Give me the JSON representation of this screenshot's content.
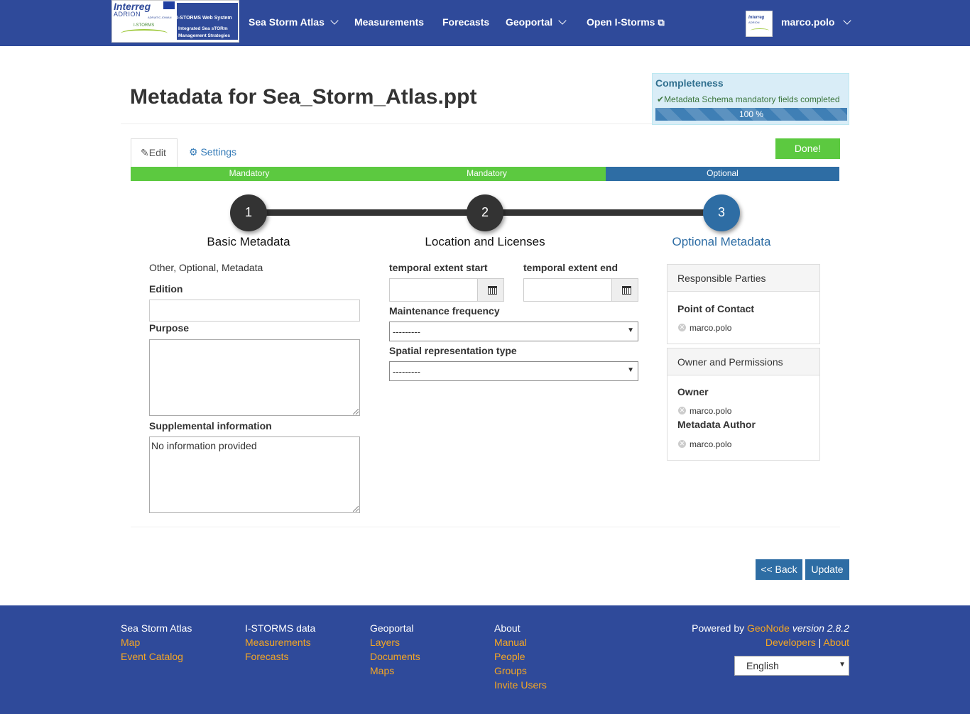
{
  "navbar": {
    "logo": {
      "interreg": "Interreg",
      "adrion": "ADRION",
      "adriatic_ionian": "ADRIATIC-IONIAN",
      "istorms_small": "I-STORMS",
      "system": "I-STORMS Web System",
      "line1": "Integrated Sea sTORm",
      "line2": "Management Strategies"
    },
    "items": [
      {
        "label": "Sea Storm Atlas",
        "dropdown": true
      },
      {
        "label": "Measurements",
        "dropdown": false
      },
      {
        "label": "Forecasts",
        "dropdown": false
      },
      {
        "label": "Geoportal",
        "dropdown": true
      },
      {
        "label": "Open I-Storms",
        "external": true
      }
    ],
    "user": "marco.polo"
  },
  "page": {
    "title": "Metadata for Sea_Storm_Atlas.ppt"
  },
  "completeness": {
    "title": "Completeness",
    "message": "Metadata Schema mandatory fields completed",
    "progress": 100,
    "progress_label": "100 %"
  },
  "tabs": {
    "edit": "Edit",
    "settings": "Settings"
  },
  "done_button": "Done!",
  "segments": [
    "Mandatory",
    "Mandatory",
    "Optional"
  ],
  "wizard": {
    "steps": [
      {
        "number": "1",
        "label": "Basic Metadata"
      },
      {
        "number": "2",
        "label": "Location and Licenses"
      },
      {
        "number": "3",
        "label": "Optional Metadata"
      }
    ],
    "active": 3
  },
  "form": {
    "category_text": "Other, Optional, Metadata",
    "edition_label": "Edition",
    "edition_value": "",
    "purpose_label": "Purpose",
    "purpose_value": "",
    "supplemental_label": "Supplemental information",
    "supplemental_value": "No information provided",
    "temporal_start_label": "temporal extent start",
    "temporal_end_label": "temporal extent end",
    "maintenance_label": "Maintenance frequency",
    "maintenance_value": "---------",
    "spatial_label": "Spatial representation type",
    "spatial_value": "---------"
  },
  "responsible_parties": {
    "heading": "Responsible Parties",
    "point_of_contact_label": "Point of Contact",
    "point_of_contact": "marco.polo"
  },
  "owner_permissions": {
    "heading": "Owner and Permissions",
    "owner_label": "Owner",
    "owner": "marco.polo",
    "metadata_author_label": "Metadata Author",
    "metadata_author": "marco.polo"
  },
  "buttons": {
    "back": "<< Back",
    "update": "Update"
  },
  "footer": {
    "columns": [
      {
        "heading": "Sea Storm Atlas",
        "links": [
          "Map",
          "Event Catalog"
        ]
      },
      {
        "heading": "I-STORMS data",
        "links": [
          "Measurements",
          "Forecasts"
        ]
      },
      {
        "heading": "Geoportal",
        "links": [
          "Layers",
          "Documents",
          "Maps"
        ]
      },
      {
        "heading": "About",
        "links": [
          "Manual",
          "People",
          "Groups",
          "Invite Users"
        ]
      }
    ],
    "powered_by": "Powered by",
    "geonode": "GeoNode",
    "version": "version 2.8.2",
    "developers": "Developers",
    "separator": "|",
    "about": "About",
    "language": "English"
  },
  "colors": {
    "navbar": "#2f4a9a",
    "accent": "#2e6da4",
    "success": "#5cc940",
    "link_orange": "#f5a623"
  }
}
